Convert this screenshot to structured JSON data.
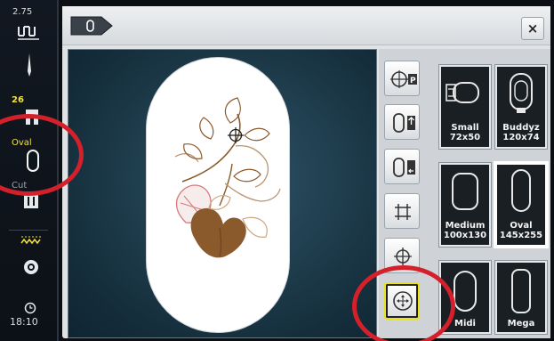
{
  "sidebar": {
    "stitch_width": "2.75",
    "tension": "26",
    "hoop_label": "Oval",
    "cut_label": "Cut",
    "time": "18:10"
  },
  "titlebar": {
    "close_label": "×"
  },
  "tools": [
    {
      "name": "center-hoop-button",
      "icon": "crosshair-p-icon"
    },
    {
      "name": "move-hoop-back-button",
      "icon": "hoop-arrow-up-icon"
    },
    {
      "name": "move-hoop-left-button",
      "icon": "hoop-arrow-left-icon"
    },
    {
      "name": "grid-button",
      "icon": "grid-icon"
    },
    {
      "name": "center-mark-button",
      "icon": "crosshair-icon"
    },
    {
      "name": "hoop-center-active-button",
      "icon": "hoop-center-icon"
    }
  ],
  "hoops": [
    {
      "name": "Small",
      "size": "72x50"
    },
    {
      "name": "Buddyz",
      "size": "120x74"
    },
    {
      "name": "Medium",
      "size": "100x130"
    },
    {
      "name": "Oval",
      "size": "145x255",
      "selected": true
    },
    {
      "name": "Midi",
      "size": ""
    },
    {
      "name": "Mega",
      "size": ""
    }
  ],
  "colors": {
    "accent_yellow": "#f2e23a",
    "annotation_red": "#d4202a",
    "canvas_blue": "#1e3f52",
    "embroidery_brown": "#8a5a2c"
  }
}
